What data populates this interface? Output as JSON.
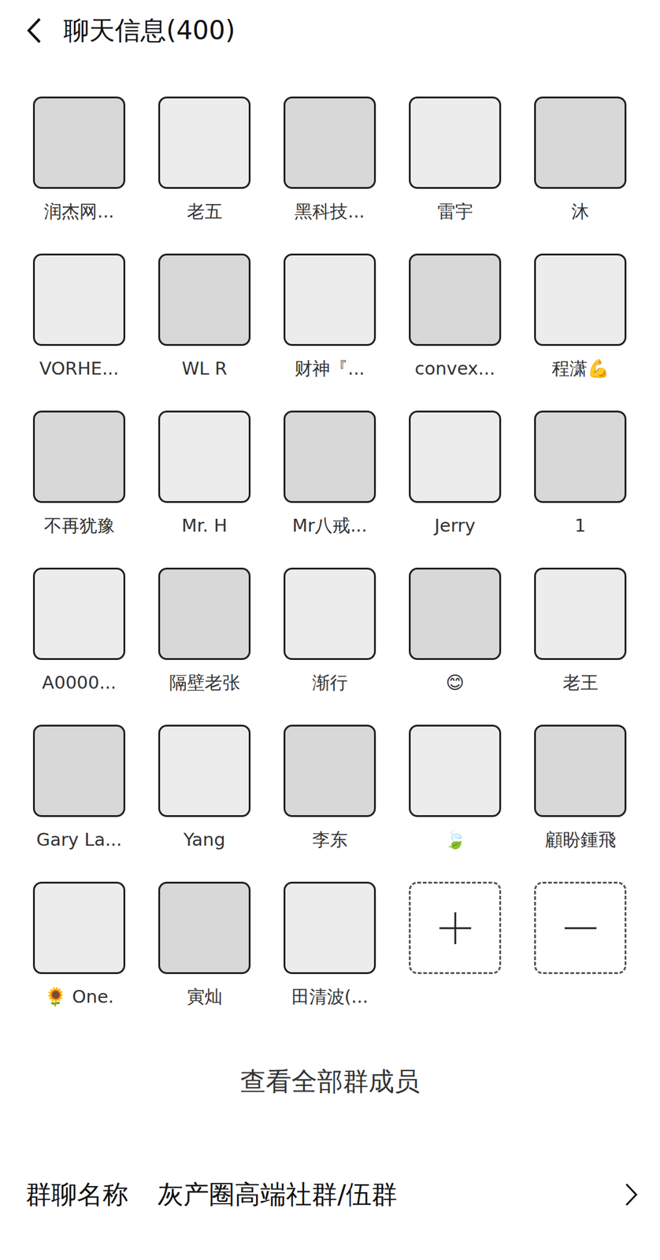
{
  "header": {
    "title": "聊天信息(400)"
  },
  "members": [
    {
      "name": "润杰网..."
    },
    {
      "name": "老五"
    },
    {
      "name": "黑科技..."
    },
    {
      "name": "雷宇"
    },
    {
      "name": "沐"
    },
    {
      "name": "VORHE..."
    },
    {
      "name": "WL R"
    },
    {
      "name": "财神『..."
    },
    {
      "name": "convex..."
    },
    {
      "name": "程潇💪"
    },
    {
      "name": "不再犹豫"
    },
    {
      "name": "Mr. H"
    },
    {
      "name": "Mr八戒..."
    },
    {
      "name": "Jerry"
    },
    {
      "name": "1"
    },
    {
      "name": "A0000..."
    },
    {
      "name": "隔壁老张"
    },
    {
      "name": "渐行"
    },
    {
      "name": "😊"
    },
    {
      "name": "老王"
    },
    {
      "name": "Gary La..."
    },
    {
      "name": "Yang"
    },
    {
      "name": "李东"
    },
    {
      "name": "🍃"
    },
    {
      "name": "顧盼鍾飛"
    },
    {
      "name": "🌻 One."
    },
    {
      "name": "寅灿"
    },
    {
      "name": "田清波(..."
    }
  ],
  "view_all": "查看全部群成员",
  "group_name": {
    "label": "群聊名称",
    "value": "灰产圈高端社群/伍群"
  }
}
